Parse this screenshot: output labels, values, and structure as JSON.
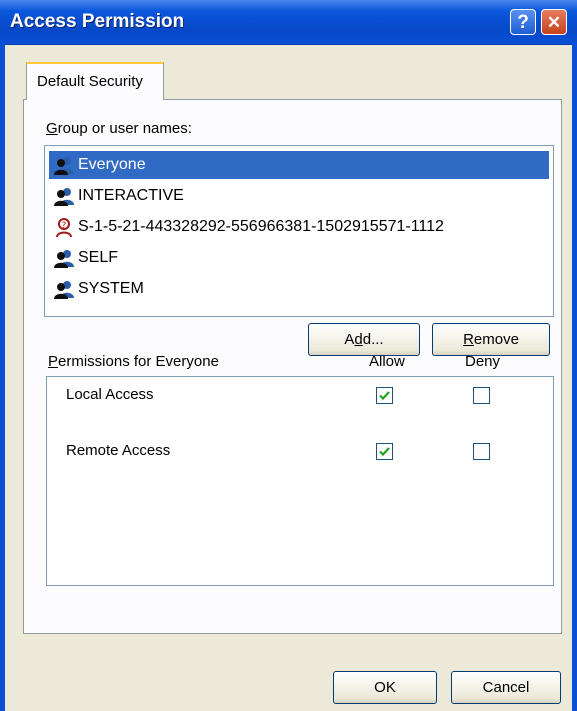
{
  "window": {
    "title": "Access Permission"
  },
  "title_buttons": {
    "help": "?",
    "close": "✕"
  },
  "tabs": [
    {
      "label": "Default Security"
    }
  ],
  "group_label": "Group or user names:",
  "group_label_accel": "G",
  "group_label_rest": "roup or user names:",
  "users": [
    {
      "name": "Everyone",
      "icon": "group-icon",
      "selected": true
    },
    {
      "name": "INTERACTIVE",
      "icon": "group-icon",
      "selected": false
    },
    {
      "name": "S-1-5-21-443328292-556966381-1502915571-1112",
      "icon": "unknown-user-icon",
      "selected": false
    },
    {
      "name": "SELF",
      "icon": "group-icon",
      "selected": false
    },
    {
      "name": "SYSTEM",
      "icon": "group-icon",
      "selected": false
    }
  ],
  "buttons": {
    "add": "Add...",
    "add_pre": "A",
    "add_accel": "d",
    "add_post": "d...",
    "remove": "Remove",
    "remove_accel": "R",
    "remove_post": "emove",
    "ok": "OK",
    "cancel": "Cancel"
  },
  "permissions": {
    "label": "Permissions for Everyone",
    "label_accel": "P",
    "label_rest": "ermissions for Everyone",
    "col_allow": "Allow",
    "col_deny": "Deny",
    "rows": [
      {
        "name": "Local Access",
        "allow": true,
        "deny": false
      },
      {
        "name": "Remote Access",
        "allow": true,
        "deny": false
      }
    ]
  },
  "colors": {
    "titlebar": "#0a4fd6",
    "selection": "#316ac5",
    "dialog_bg": "#ece9d8",
    "checkmark": "#21a121"
  }
}
